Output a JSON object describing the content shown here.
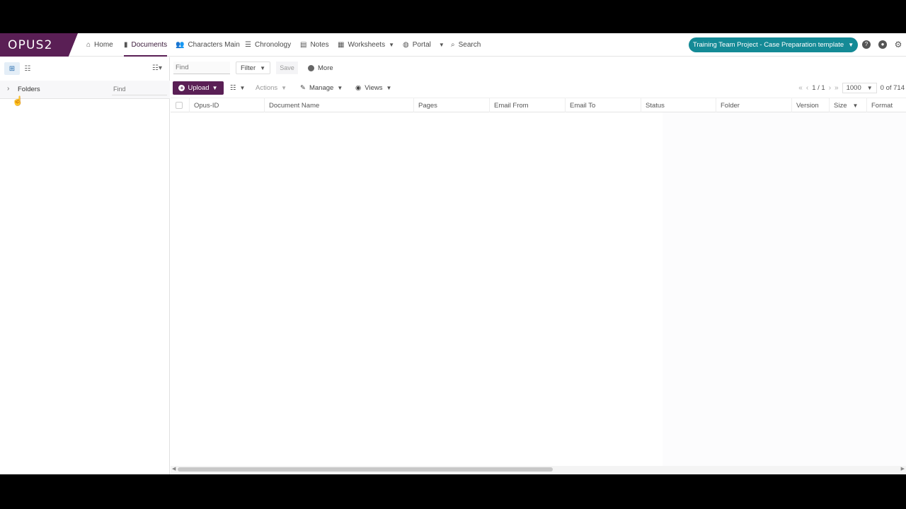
{
  "app": {
    "logo": "OPUS2"
  },
  "nav": {
    "items": [
      {
        "label": "Home",
        "icon": "home-icon"
      },
      {
        "label": "Documents",
        "icon": "document-icon",
        "active": true
      },
      {
        "label": "Characters Main",
        "icon": "people-icon"
      },
      {
        "label": "Chronology",
        "icon": "list-icon"
      },
      {
        "label": "Notes",
        "icon": "note-icon"
      },
      {
        "label": "Worksheets",
        "icon": "table-icon"
      },
      {
        "label": "Portal",
        "icon": "globe-icon"
      },
      {
        "label": "Search",
        "icon": "search-icon"
      }
    ],
    "project": "Training Team Project - Case Preparation template"
  },
  "sidebar": {
    "folders_label": "Folders",
    "find_placeholder": "Find"
  },
  "toolbar": {
    "find_placeholder": "Find",
    "filter": "Filter",
    "save": "Save",
    "more": "More",
    "upload": "Upload",
    "actions": "Actions",
    "manage": "Manage",
    "views": "Views"
  },
  "pager": {
    "page": "1 / 1",
    "per_page": "1000",
    "count": "0 of 714"
  },
  "grid": {
    "columns": [
      "Opus-ID",
      "Document Name",
      "Pages",
      "Email From",
      "Email To",
      "Status",
      "Folder",
      "Version",
      "Size",
      "Format"
    ]
  },
  "colors": {
    "brand": "#5a1f55",
    "project_pill": "#148a96"
  }
}
